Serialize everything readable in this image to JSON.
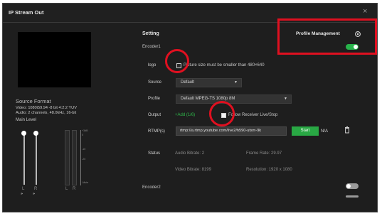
{
  "dialog": {
    "title": "IP Stream Out",
    "close_label": "×"
  },
  "source_format": {
    "heading": "Source Format",
    "video": "Video: 1080i59.94 -8 bit 4:2:2 YUV",
    "audio": "Audio: 2 channels, 48.0kHz, 16-bit"
  },
  "main_level": {
    "label": "Main Level",
    "channels": [
      "L",
      "R"
    ],
    "meter_channels": [
      "L",
      "R"
    ],
    "meter_scale": [
      "+3dB",
      "0",
      "-10",
      "-20",
      "-Mute"
    ],
    "speaker_glyph": "🕪"
  },
  "setting": {
    "heading": "Setting",
    "encoder1_label": "Encoder1",
    "logo_label": "logo",
    "logo_hint": "Picture size must be smaller than 480×640",
    "logo_checked": false,
    "source_label": "Source",
    "source_value": "Default",
    "profile_label": "Profile",
    "profile_value": "Default MPEG-TS 1080p 8M",
    "output_label": "Output",
    "output_add": "+Add (1/6)",
    "follow_label": "Follow Receiver Live/Stop",
    "follow_checked": true,
    "rtmp_label": "RTMP(s)",
    "rtmp_value": "rtmp://a.rtmp.youtube.com/live2/h590-utsm-9k",
    "start_label": "Start",
    "status_value": "N/A",
    "status_label": "Status",
    "audio_bitrate": "Audio Bitrate: 2",
    "video_bitrate": "Video Bitrate: 8199",
    "frame_rate": "Frame Rate: 29.97",
    "resolution": "Resolution: 1920 x 1080",
    "encoder2_label": "Encoder2"
  },
  "profile_management": {
    "label": "Profile Management",
    "enabled": true
  },
  "encoder2": {
    "enabled": false
  },
  "icons": {
    "gear": "gear-icon",
    "trash": "trash-icon",
    "chevron": "chevron-down-icon",
    "speaker": "speaker-icon"
  },
  "colors": {
    "accent_green": "#27b34a",
    "dialog_bg": "#1e1e1e",
    "annotation_red": "#e01020"
  }
}
